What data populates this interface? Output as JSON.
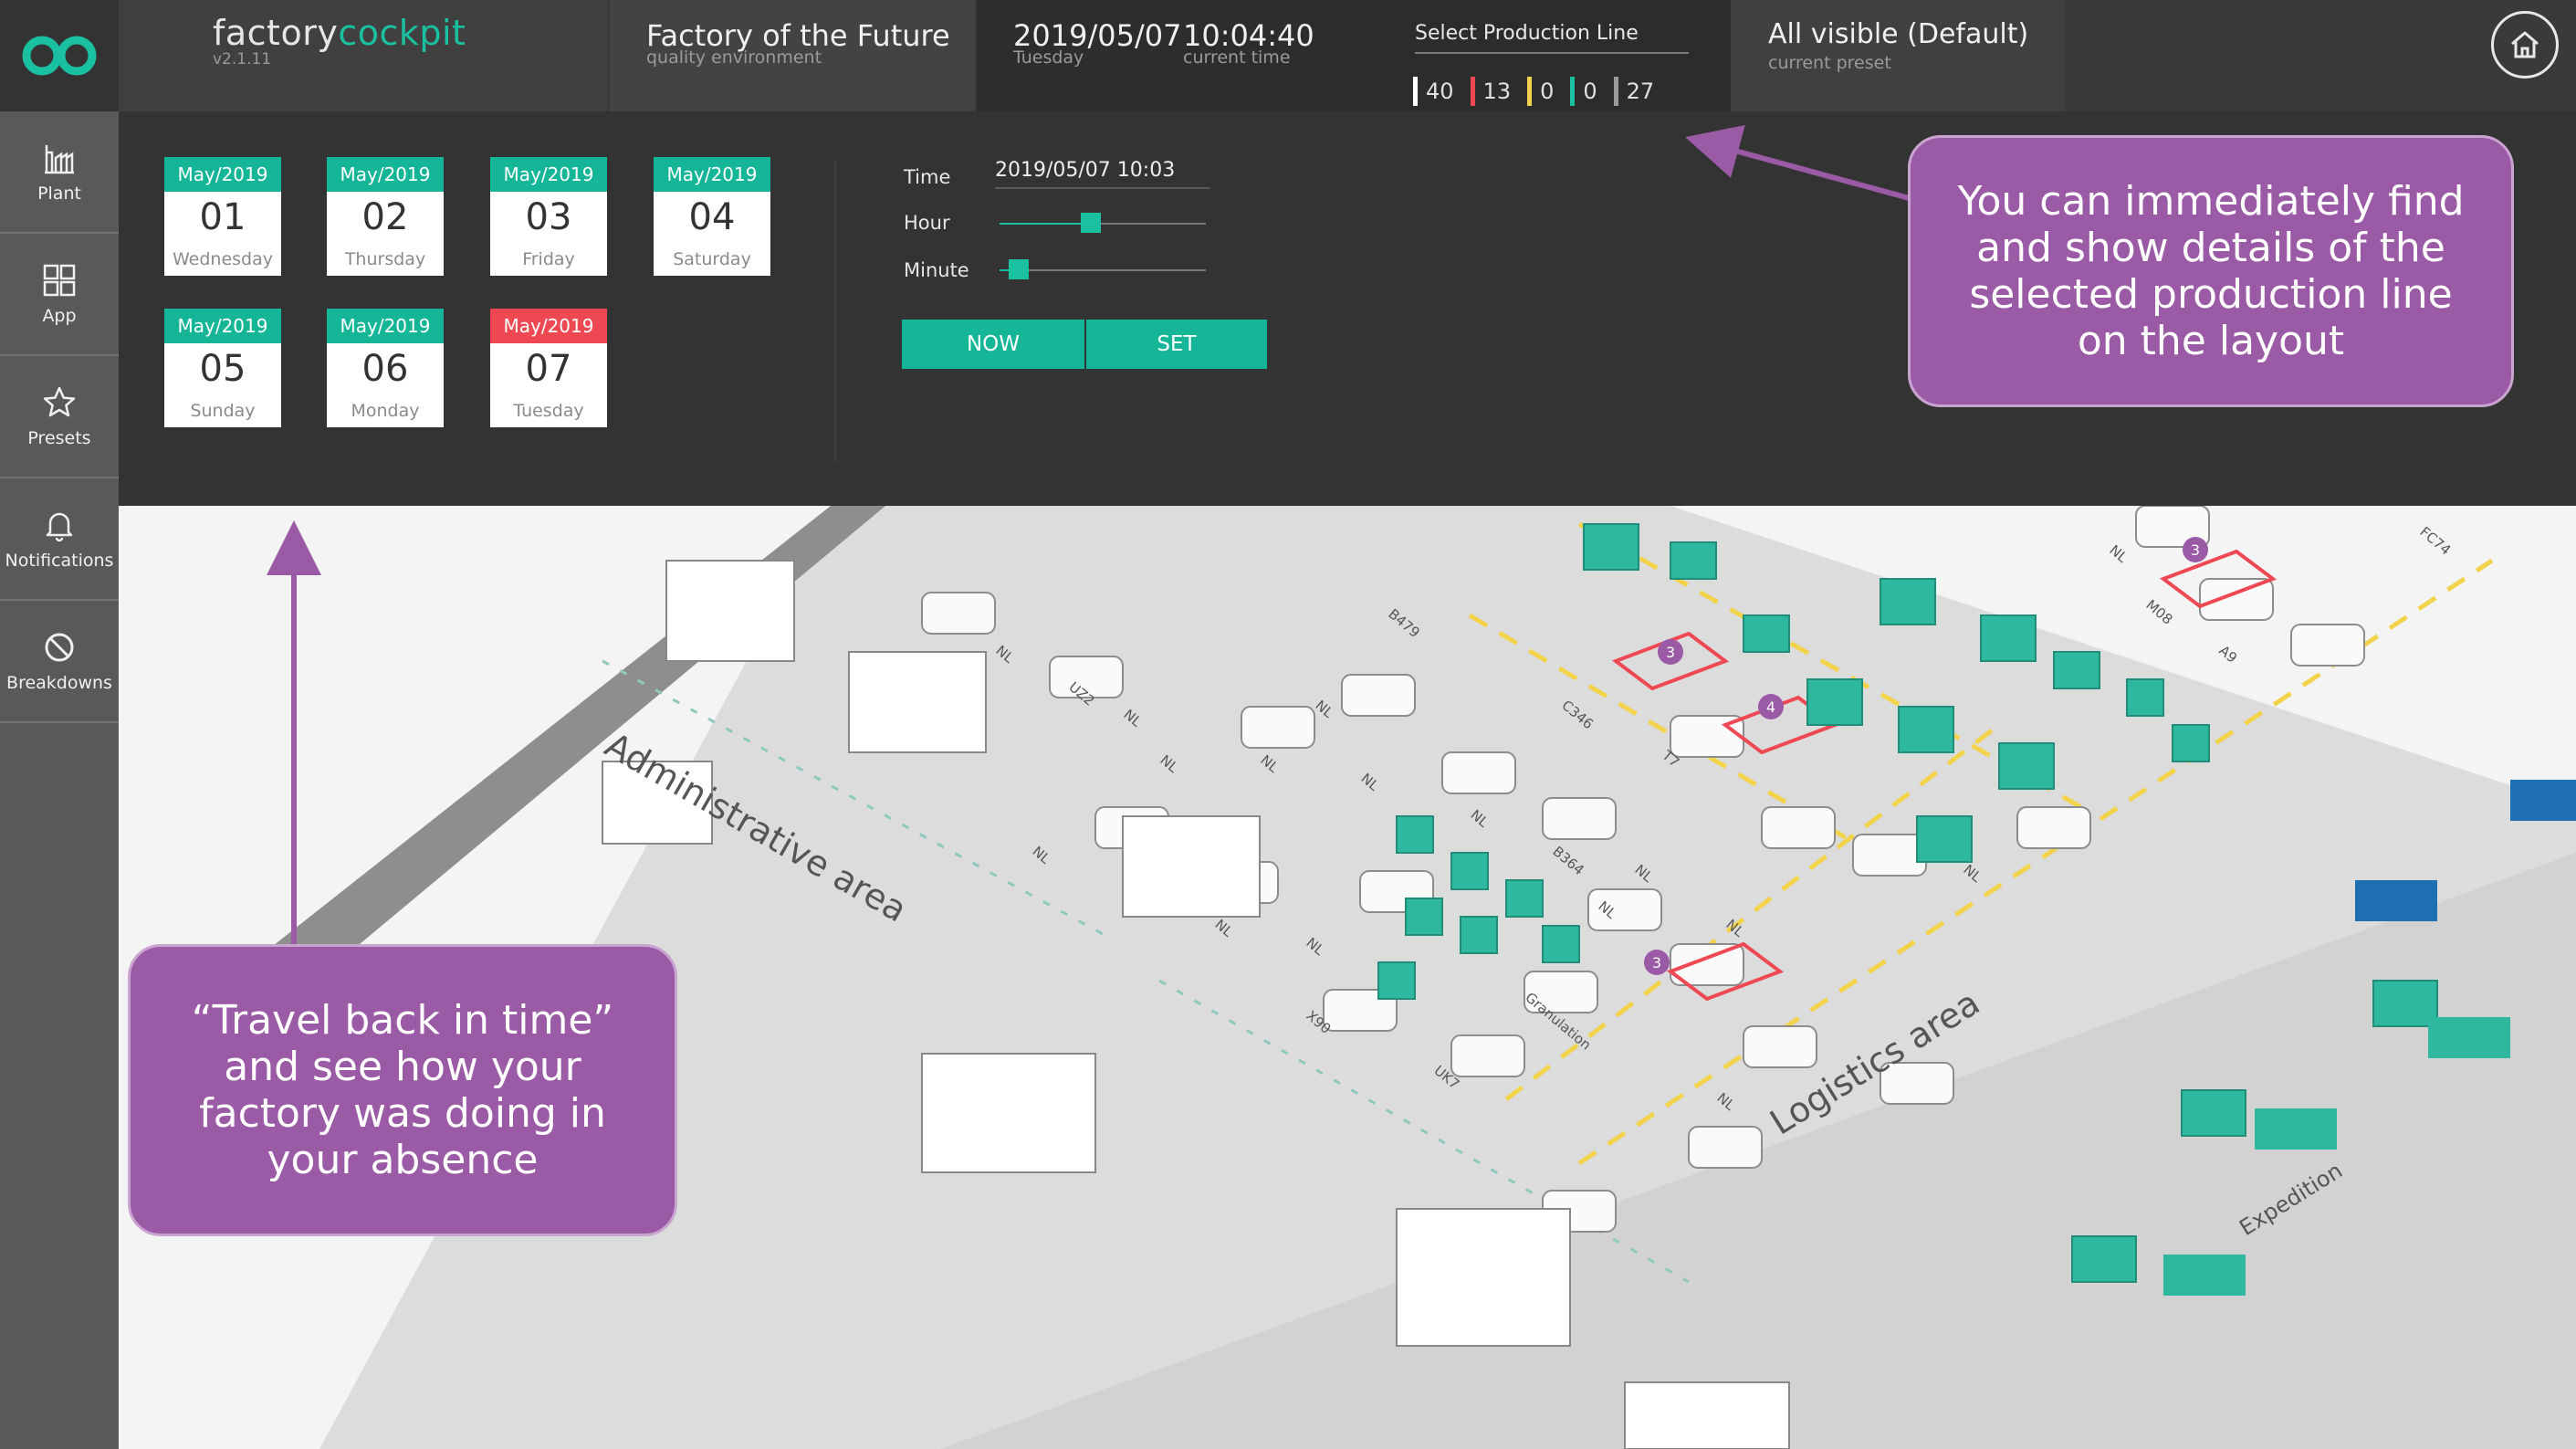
{
  "app": {
    "brand_plain": "factory",
    "brand_accent": "cockpit",
    "version": "v2.1.11",
    "accent_color": "#19c1a0"
  },
  "header": {
    "factory_title": "Factory of the Future",
    "factory_subtitle": "quality environment",
    "date": "2019/05/07",
    "day": "Tuesday",
    "time": "10:04:40",
    "time_label": "current time",
    "select_line_label": "Select Production Line",
    "line_counts": [
      {
        "value": "40",
        "color": "#ffffff"
      },
      {
        "value": "13",
        "color": "#ee4852"
      },
      {
        "value": "0",
        "color": "#f2d34b"
      },
      {
        "value": "0",
        "color": "#19c1a0"
      },
      {
        "value": "27",
        "color": "#9a9a9a"
      }
    ],
    "preset_value": "All visible (Default)",
    "preset_label": "current preset",
    "home_icon": "home-icon"
  },
  "sidebar": {
    "items": [
      {
        "label": "Plant",
        "icon": "plant-icon"
      },
      {
        "label": "App",
        "icon": "app-grid-icon"
      },
      {
        "label": "Presets",
        "icon": "star-icon"
      },
      {
        "label": "Notifications",
        "icon": "bell-icon"
      },
      {
        "label": "Breakdowns",
        "icon": "breakdown-icon"
      }
    ]
  },
  "calendar": {
    "days": [
      {
        "month": "May/2019",
        "day": "01",
        "weekday": "Wednesday",
        "today": false
      },
      {
        "month": "May/2019",
        "day": "02",
        "weekday": "Thursday",
        "today": false
      },
      {
        "month": "May/2019",
        "day": "03",
        "weekday": "Friday",
        "today": false
      },
      {
        "month": "May/2019",
        "day": "04",
        "weekday": "Saturday",
        "today": false
      },
      {
        "month": "May/2019",
        "day": "05",
        "weekday": "Sunday",
        "today": false
      },
      {
        "month": "May/2019",
        "day": "06",
        "weekday": "Monday",
        "today": false
      },
      {
        "month": "May/2019",
        "day": "07",
        "weekday": "Tuesday",
        "today": true
      }
    ]
  },
  "time_picker": {
    "time_label": "Time",
    "time_value": "2019/05/07 10:03",
    "hour_label": "Hour",
    "hour_value": 10,
    "minute_label": "Minute",
    "minute_value": 3,
    "now_label": "NOW",
    "set_label": "SET"
  },
  "map": {
    "areas": {
      "administrative": "Administrative area",
      "logistics": "Logistics area",
      "expedition": "Expedition"
    },
    "line_labels": [
      "NL",
      "UZ2",
      "NL",
      "NL",
      "NL",
      "NL",
      "B479",
      "NL",
      "NL",
      "NL",
      "NL",
      "NL",
      "X90",
      "NL",
      "Granulation",
      "UK7",
      "C346",
      "T7",
      "B364",
      "NL",
      "NL",
      "NL",
      "NL",
      "NL",
      "M08",
      "A9",
      "FC74"
    ],
    "badges": [
      "3",
      "4",
      "3",
      "3"
    ]
  },
  "callouts": {
    "top_right": "You can immediately find\nand show details of the\nselected production line\non the layout",
    "bottom_left": "“Travel back in time”\nand see how your\nfactory was doing in\nyour absence"
  }
}
